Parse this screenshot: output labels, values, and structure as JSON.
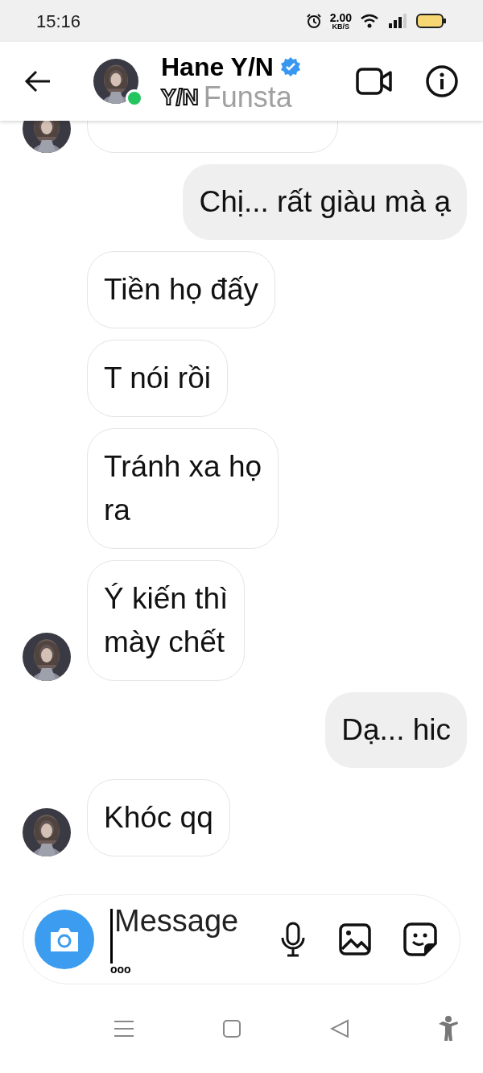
{
  "status_bar": {
    "time": "15:16",
    "speed_value": "2.00",
    "speed_unit": "KB/S"
  },
  "header": {
    "name": "Hane Y/N",
    "verified": true,
    "online": true,
    "subtitle": "Y/N",
    "overlay_text": "Funsta"
  },
  "messages": [
    {
      "outgoing": false,
      "avatar": true
    },
    {
      "outgoing": true,
      "avatar": false,
      "lines": [
        "Chị... rất giàu mà ạ"
      ]
    },
    {
      "outgoing": false,
      "avatar": false,
      "lines": [
        "Tiền họ đấy"
      ]
    },
    {
      "outgoing": false,
      "avatar": false,
      "lines": [
        "T nói rồi"
      ]
    },
    {
      "outgoing": false,
      "avatar": false,
      "lines": [
        "Tránh xa họ",
        "ra"
      ]
    },
    {
      "outgoing": false,
      "avatar": true,
      "lines": [
        "Ý kiến thì",
        "mày chết"
      ]
    },
    {
      "outgoing": true,
      "avatar": false,
      "lines": [
        "Dạ... hic"
      ]
    },
    {
      "outgoing": false,
      "avatar": true,
      "lines": [
        "Khóc qq"
      ]
    }
  ],
  "composer": {
    "placeholder": "Message",
    "dots": "ooo"
  }
}
